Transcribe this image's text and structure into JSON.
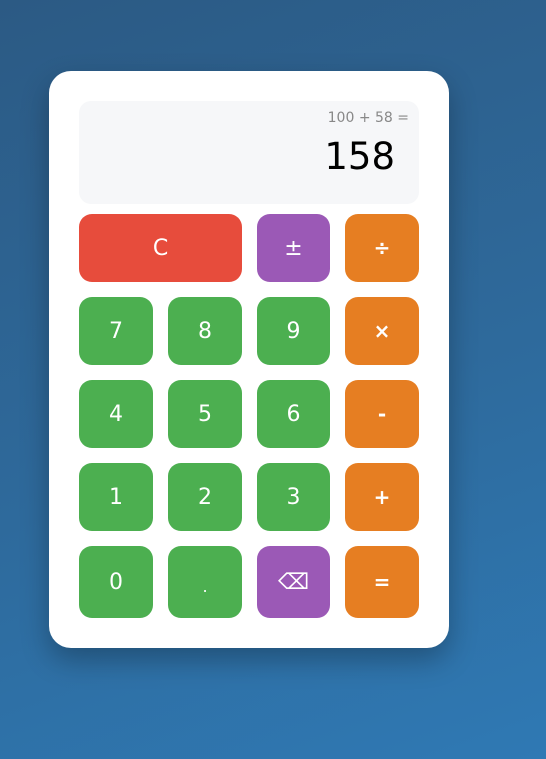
{
  "display": {
    "expression": "100 + 58 =",
    "result": "158"
  },
  "buttons": {
    "clear": "C",
    "plus_minus": "±",
    "divide": "÷",
    "seven": "7",
    "eight": "8",
    "nine": "9",
    "multiply": "×",
    "four": "4",
    "five": "5",
    "six": "6",
    "subtract": "-",
    "one": "1",
    "two": "2",
    "three": "3",
    "add": "+",
    "zero": "0",
    "decimal": ".",
    "backspace": "⌫",
    "equals": "="
  },
  "colors": {
    "number": "#4caf50",
    "operator": "#e67e22",
    "clear": "#e74c3c",
    "function": "#9b59b6"
  }
}
